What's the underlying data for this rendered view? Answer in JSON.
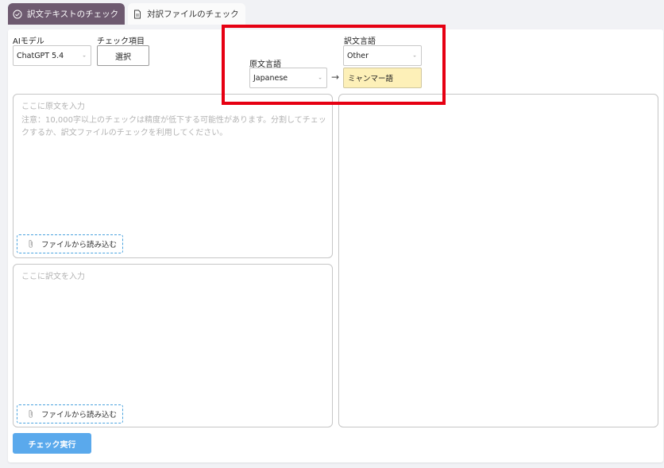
{
  "tabs": [
    {
      "label": "訳文テキストのチェック",
      "icon": "check-circle-icon",
      "active": true
    },
    {
      "label": "対訳ファイルのチェック",
      "icon": "document-icon",
      "active": false
    }
  ],
  "ai_model": {
    "label": "AIモデル",
    "value": "ChatGPT 5.4"
  },
  "check_items": {
    "label": "チェック項目",
    "button": "選択"
  },
  "source_lang": {
    "label": "原文言語",
    "value": "Japanese"
  },
  "target_lang": {
    "label": "訳文言語",
    "value": "Other",
    "custom": "ミャンマー語"
  },
  "source_text": {
    "placeholder": "ここに原文を入力",
    "note": "注意：10,000字以上のチェックは精度が低下する可能性があります。分割してチェックするか、訳文ファイルのチェックを利用してください。"
  },
  "target_text": {
    "placeholder": "ここに訳文を入力"
  },
  "file_load_label": "ファイルから読み込む",
  "run_button": "チェック実行",
  "colors": {
    "accent": "#6e5a70",
    "run": "#5aa9ec",
    "highlight": "#e60012",
    "custom_lang_bg": "#fdf0b8"
  }
}
